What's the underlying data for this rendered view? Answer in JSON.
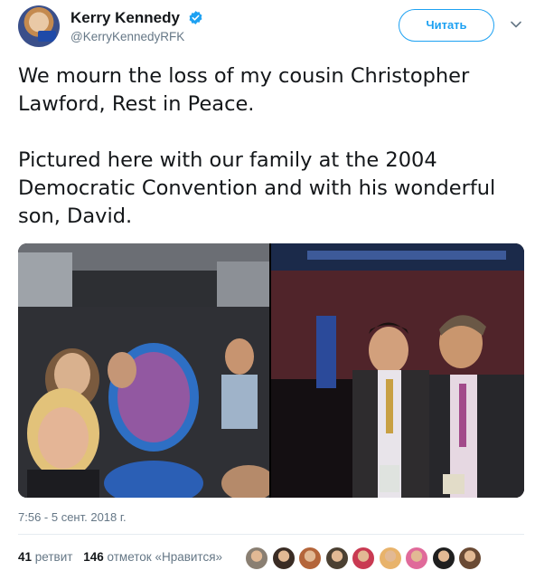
{
  "author": {
    "display_name": "Kerry Kennedy",
    "handle": "@KerryKennedyRFK",
    "verified": true,
    "avatar_icon": "profile-photo"
  },
  "follow_button": {
    "label": "Читать"
  },
  "menu_icon": "chevron-down-icon",
  "tweet": {
    "text": "We mourn the loss of my cousin Christopher Lawford, Rest in Peace.\n\nPictured here with our family at the 2004 Democratic Convention and with his wonderful son, David."
  },
  "media": [
    {
      "description_icon": "photo-bus-family"
    },
    {
      "description_icon": "photo-convention-father-son"
    }
  ],
  "timestamp": "7:56 - 5 сент. 2018 г.",
  "stats": {
    "retweets_count": "41",
    "retweets_label": "ретвит",
    "likes_count": "146",
    "likes_label": "отметок «Нравится»"
  },
  "likers": [
    {
      "color": "#8a7f72"
    },
    {
      "color": "#3a2c24"
    },
    {
      "color": "#b4653a"
    },
    {
      "color": "#4b4032"
    },
    {
      "color": "#c93a52"
    },
    {
      "color": "#e8b36b"
    },
    {
      "color": "#e06a9a"
    },
    {
      "color": "#1f1f1f"
    },
    {
      "color": "#6a4a34"
    }
  ],
  "colors": {
    "accent": "#1da1f2",
    "muted": "#657786",
    "text": "#14171a"
  }
}
